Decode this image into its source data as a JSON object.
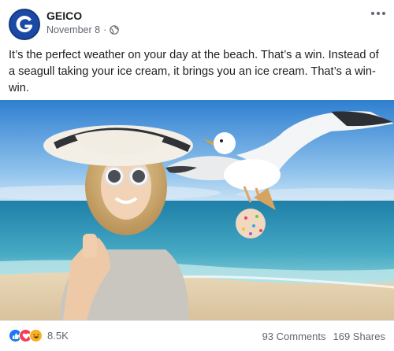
{
  "post": {
    "author": "GEICO",
    "date": "November 8",
    "separator": "·",
    "caption": "It’s the perfect weather on your day at the beach. That’s a win. Instead of a seagull taking your ice cream, it brings you an ice cream. That’s a win-win.",
    "reactions": {
      "icons": [
        "like-icon",
        "love-icon",
        "haha-icon"
      ],
      "count": "8.5K"
    },
    "comments": "93 Comments",
    "shares": "169 Shares"
  },
  "colors": {
    "brand_blue": "#1a4aa3",
    "like": "#1877f2",
    "love": "#f33e58",
    "haha": "#f7b125",
    "meta_gray": "#606770"
  }
}
